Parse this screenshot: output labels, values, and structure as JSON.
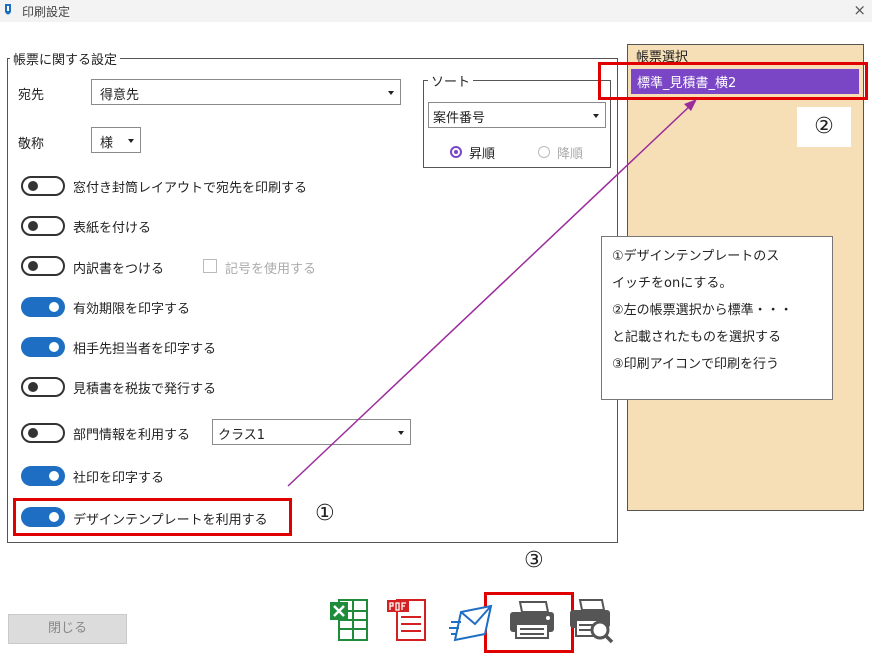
{
  "window": {
    "title": "印刷設定",
    "close_symbol": "×"
  },
  "settings": {
    "legend": "帳票に関する設定",
    "recipient": {
      "label": "宛先",
      "value": "得意先"
    },
    "honorific": {
      "label": "敬称",
      "value": "様"
    },
    "sort": {
      "legend": "ソート",
      "value": "案件番号",
      "ascending": "昇順",
      "descending": "降順",
      "selected": "昇順"
    },
    "toggles": [
      {
        "label": "窓付き封筒レイアウトで宛先を印刷する",
        "on": false
      },
      {
        "label": "表紙を付ける",
        "on": false
      },
      {
        "label": "内訳書をつける",
        "on": false
      },
      {
        "label": "有効期限を印字する",
        "on": true
      },
      {
        "label": "相手先担当者を印字する",
        "on": true
      },
      {
        "label": "見積書を税抜で発行する",
        "on": false
      },
      {
        "label": "部門情報を利用する",
        "on": false
      },
      {
        "label": "社印を印字する",
        "on": true
      },
      {
        "label": "デザインテンプレートを利用する",
        "on": true
      }
    ],
    "symbol_checkbox": {
      "label": "記号を使用する",
      "checked": false
    },
    "department_class": {
      "value": "クラス1"
    }
  },
  "form_selection": {
    "legend": "帳票選択",
    "items": [
      "標準_見積書_横2"
    ],
    "selected": "標準_見積書_横2"
  },
  "annotations": {
    "marker_1": "①",
    "marker_2": "②",
    "marker_3": "③",
    "note_lines": [
      "①デザインテンプレートのス",
      "イッチをonにする。",
      "②左の帳票選択から標準・・・",
      "と記載されたものを選択する",
      "③印刷アイコンで印刷を行う"
    ],
    "highlight_color": "#e00000",
    "arrow_color": "#9b2c9b"
  },
  "footer": {
    "close_label": "閉じる",
    "tools": [
      {
        "name": "excel-export",
        "icon": "excel-icon",
        "color": "#1e8c3a"
      },
      {
        "name": "pdf-export",
        "icon": "pdf-icon",
        "color": "#d42020"
      },
      {
        "name": "mail-send",
        "icon": "mail-icon",
        "color": "#1e6ec3"
      },
      {
        "name": "print",
        "icon": "printer-icon",
        "color": "#555555"
      },
      {
        "name": "print-preview",
        "icon": "print-preview-icon",
        "color": "#555555"
      }
    ]
  },
  "colors": {
    "toggle_on": "#1e6ec3",
    "selection": "#7a46c6",
    "form_panel_bg": "#f6dfb6"
  }
}
